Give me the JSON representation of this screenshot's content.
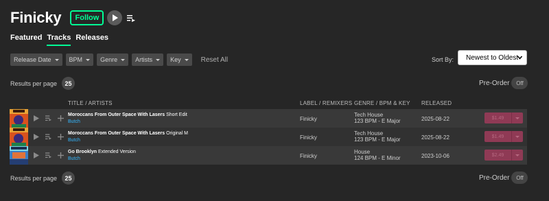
{
  "header": {
    "artist_name": "Finicky",
    "follow_label": "Follow",
    "play_icon": "play-icon",
    "queue_icon": "add-to-queue-icon"
  },
  "tabs": [
    {
      "label": "Featured",
      "active": false
    },
    {
      "label": "Tracks",
      "active": true
    },
    {
      "label": "Releases",
      "active": false
    }
  ],
  "filters": {
    "items": [
      "Release Date",
      "BPM",
      "Genre",
      "Artists",
      "Key"
    ],
    "reset_label": "Reset All"
  },
  "sort": {
    "label": "Sort By:",
    "selected": "Newest to Oldest"
  },
  "pagination": {
    "label": "Results per page",
    "value": "25"
  },
  "preorder": {
    "label": "Pre-Order",
    "toggle": "Off"
  },
  "columns": {
    "title": "TITLE / ARTISTS",
    "label": "LABEL / REMIXERS",
    "genre": "GENRE / BPM & KEY",
    "released": "RELEASED"
  },
  "tracks": [
    {
      "title": "Moroccans From Outer Space With Lasers",
      "mix": "Short Edit",
      "artist": "Butch",
      "label": "Finicky",
      "genre": "Tech House",
      "bpm_key": "123 BPM - E Major",
      "released": "2025-08-22",
      "price": "$1.49"
    },
    {
      "title": "Moroccans From Outer Space With Lasers",
      "mix": "Original M",
      "artist": "Butch",
      "label": "Finicky",
      "genre": "Tech House",
      "bpm_key": "123 BPM - E Major",
      "released": "2025-08-22",
      "price": "$1.49"
    },
    {
      "title": "Go Brooklyn",
      "mix": "Extended Version",
      "artist": "Butch",
      "label": "Finicky",
      "genre": "House",
      "bpm_key": "124 BPM - E Minor",
      "released": "2023-10-06",
      "price": "$2.49"
    }
  ],
  "colors": {
    "accent": "#01ff95",
    "artist_link": "#33b7ff",
    "price_bg": "#8f3a55",
    "background": "#262626"
  }
}
